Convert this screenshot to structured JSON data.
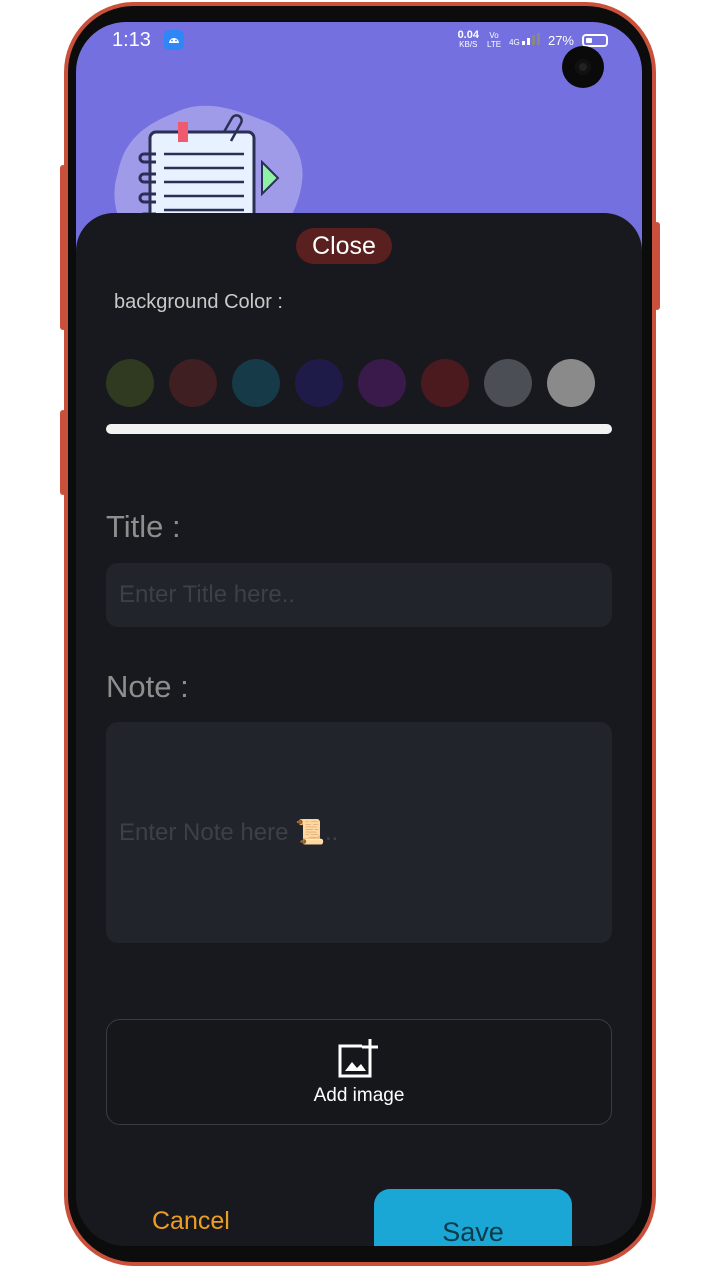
{
  "status_bar": {
    "time": "1:13",
    "speed_value": "0.04",
    "speed_unit": "KB/S",
    "volte_top": "Vo",
    "volte_bottom": "LTE",
    "network": "4G",
    "battery": "27%"
  },
  "sheet": {
    "close_label": "Close",
    "background_color_label": "background Color :",
    "swatch_colors": [
      "#2f3a20",
      "#3f1f21",
      "#163a47",
      "#1e1b48",
      "#3a1a4a",
      "#4b1a1e",
      "#4c4e55",
      "#8a8a8a"
    ],
    "title_label": "Title :",
    "title_placeholder": "Enter Title here..",
    "note_label": "Note  :",
    "note_placeholder": "Enter Note here 📜..",
    "add_image_label": "Add image",
    "cancel_label": "Cancel",
    "save_label": "Save"
  }
}
